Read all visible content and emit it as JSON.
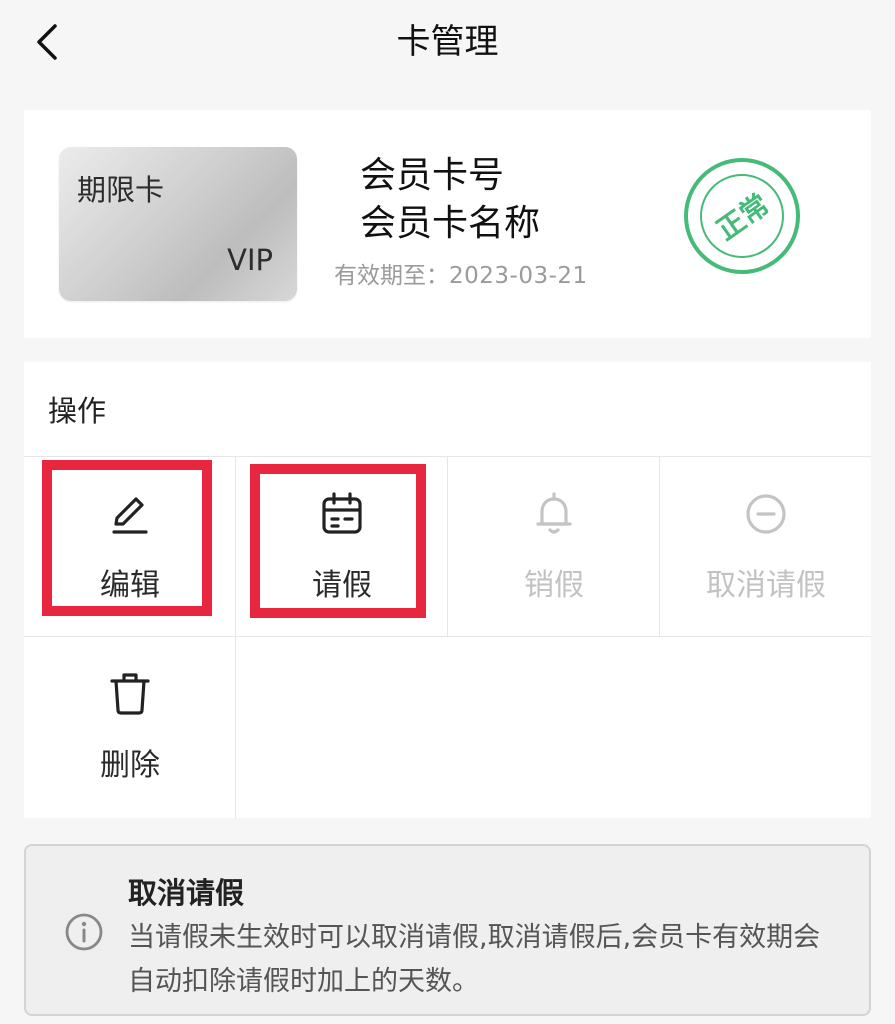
{
  "header": {
    "title": "卡管理"
  },
  "card": {
    "type_label": "期限卡",
    "vip_label": "VIP",
    "number_label": "会员卡号",
    "name_label": "会员卡名称",
    "expiry_prefix": "有效期至：",
    "expiry_date": "2023-03-21",
    "status": "正常",
    "status_color": "#33b36b"
  },
  "operations": {
    "title": "操作",
    "items": [
      {
        "label": "编辑",
        "icon": "pencil-icon",
        "enabled": true
      },
      {
        "label": "请假",
        "icon": "calendar-icon",
        "enabled": true
      },
      {
        "label": "销假",
        "icon": "bell-icon",
        "enabled": false
      },
      {
        "label": "取消请假",
        "icon": "minus-circle-icon",
        "enabled": false
      },
      {
        "label": "删除",
        "icon": "trash-icon",
        "enabled": true
      }
    ],
    "highlight_color": "#e9263f"
  },
  "note": {
    "title": "取消请假",
    "text": "当请假未生效时可以取消请假,取消请假后,会员卡有效期会自动扣除请假时加上的天数。",
    "icon": "info-icon"
  }
}
